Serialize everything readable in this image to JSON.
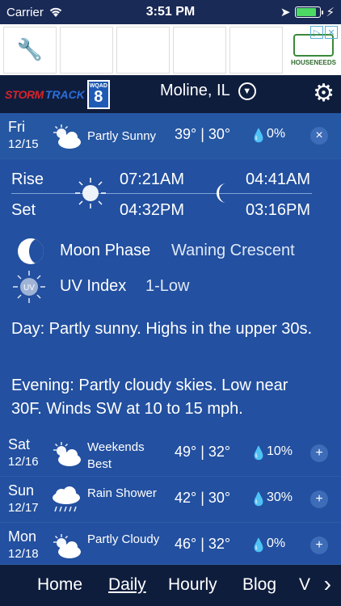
{
  "status": {
    "carrier": "Carrier",
    "time": "3:51 PM",
    "battery_level": 0.85
  },
  "ad": {
    "brand": "HOUSENEEDS",
    "choices": [
      "▷",
      "✕"
    ]
  },
  "header": {
    "logo_storm": "STORM",
    "logo_track": "TRACK",
    "logo_station": "WQAD",
    "logo_number": "8",
    "location": "Moline, IL"
  },
  "today": {
    "day": "Fri",
    "date": "12/15",
    "condition": "Partly Sunny",
    "temps": "39° | 30°",
    "precip": "0%"
  },
  "detail": {
    "rise_label": "Rise",
    "set_label": "Set",
    "sunrise": "07:21AM",
    "sunset": "04:32PM",
    "moonrise": "04:41AM",
    "moonset": "03:16PM",
    "moon_phase_label": "Moon Phase",
    "moon_phase_value": "Waning Crescent",
    "uv_label": "UV Index",
    "uv_value": "1-Low",
    "uv_icon_text": "UV",
    "day_forecast": "Day: Partly sunny. Highs in the upper 30s.",
    "evening_forecast": "Evening: Partly cloudy skies. Low near 30F. Winds SW at 10 to 15 mph."
  },
  "days": [
    {
      "day": "Sat",
      "date": "12/16",
      "condition": "Weekends Best",
      "temps": "49° | 32°",
      "precip": "10%"
    },
    {
      "day": "Sun",
      "date": "12/17",
      "condition": "Rain Shower",
      "temps": "42° | 30°",
      "precip": "30%"
    },
    {
      "day": "Mon",
      "date": "12/18",
      "condition": "Partly Cloudy",
      "temps": "46° | 32°",
      "precip": "0%"
    }
  ],
  "nav": {
    "items": [
      "Home",
      "Daily",
      "Hourly",
      "Blog",
      "V"
    ],
    "active": "Daily"
  }
}
